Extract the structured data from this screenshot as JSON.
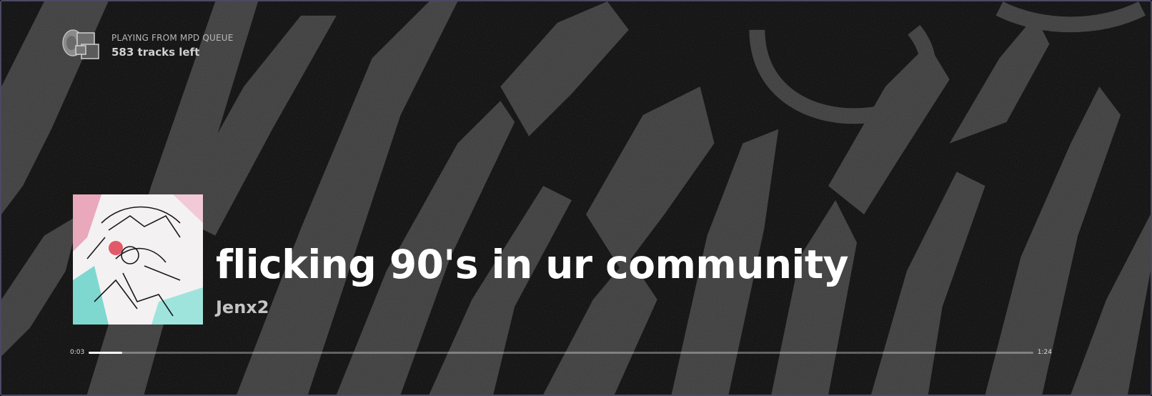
{
  "queue": {
    "label": "PLAYING FROM MPD QUEUE",
    "tracks_left": "583 tracks left",
    "icon": "mpd-speaker-screens-icon"
  },
  "track": {
    "title": "flicking 90's in ur community",
    "artist": "Jenx2",
    "cover": "album-cover-art"
  },
  "progress": {
    "elapsed": "0:03",
    "duration": "1:24",
    "fraction": 0.0357
  },
  "colors": {
    "background": "#0a0a0a",
    "streaks": "#3c3c3c",
    "title": "#ffffff",
    "artist": "#c4c4c4",
    "window_border": "#4a4a66"
  }
}
